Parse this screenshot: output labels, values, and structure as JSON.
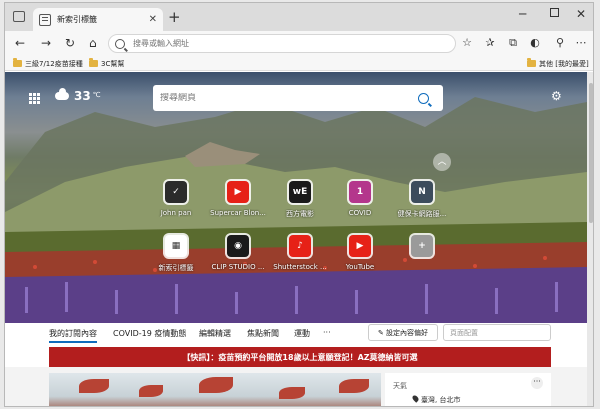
{
  "tab": {
    "title": "新索引標籤",
    "close": "✕"
  },
  "titlebar": {
    "new_tab": "+",
    "minimize": "─",
    "close": "✕"
  },
  "nav": {
    "back": "←",
    "forward": "→",
    "refresh": "↻",
    "home": "⌂"
  },
  "address": {
    "placeholder": "搜尋或輸入網址"
  },
  "bookmarks": [
    {
      "label": "三級7/12疫苗接種"
    },
    {
      "label": "3C幫幫"
    }
  ],
  "other_favorites": "其他 [我的最愛]",
  "weather": {
    "temp": "33",
    "unit": "℃"
  },
  "search": {
    "placeholder": "搜尋網頁"
  },
  "quick_links": [
    {
      "label": "John pan",
      "glyph": "✓",
      "color": "#2b2b2b"
    },
    {
      "label": "Supercar Blon...",
      "glyph": "▶",
      "color": "#e62117"
    },
    {
      "label": "西方電影",
      "glyph": "wE",
      "color": "#1a1a1a"
    },
    {
      "label": "COVID",
      "glyph": "1",
      "color": "#b4368c"
    },
    {
      "label": "健保卡網路服...",
      "glyph": "N",
      "color": "#3c4c5c"
    },
    {
      "label": "新索引標籤",
      "glyph": "▦",
      "color": "#ffffff"
    },
    {
      "label": "CLIP STUDIO ...",
      "glyph": "◉",
      "color": "#1a1a1a"
    },
    {
      "label": "Shutterstock ...",
      "glyph": "♪",
      "color": "#e62117"
    },
    {
      "label": "YouTube",
      "glyph": "▶",
      "color": "#e62117"
    },
    {
      "label": "",
      "glyph": "+",
      "color": "#9a9a9a"
    }
  ],
  "feed_tabs": [
    {
      "label": "我的訂閱內容"
    },
    {
      "label": "COVID-19 疫情動態"
    },
    {
      "label": "編輯精選"
    },
    {
      "label": "焦點新聞"
    },
    {
      "label": "運動"
    },
    {
      "label": "···"
    }
  ],
  "feed_controls": {
    "preferences": "✎ 設定內容偏好",
    "layout": "頁面配置"
  },
  "banner": "【快訊】：疫苗預約平台開放18歲以上意願登記！AZ莫德納皆可選",
  "weather_card": {
    "title": "天氣",
    "more": "···",
    "location": "臺灣, 台北市"
  }
}
